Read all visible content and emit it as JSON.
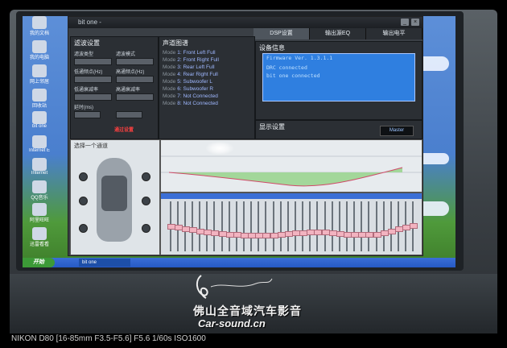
{
  "desktop": {
    "icons": [
      "我的文档",
      "我的电脑",
      "网上邻居",
      "回收站",
      "bit one",
      "Internet Explorer",
      "Internet",
      "QQ音乐",
      "阿里旺旺",
      "迅雷看看"
    ]
  },
  "app": {
    "title": "bit one -",
    "tabs": [
      "DSP设置",
      "输出源EQ",
      "输出电平"
    ],
    "filter_panel": {
      "title": "滤波设置",
      "labels": [
        "滤波类型",
        "滤波模式",
        "低通频点(Hz)",
        "高通频点(Hz)",
        "低通衰减率",
        "高通衰减率",
        "延时(ms)"
      ],
      "pass_button": "通过设置"
    },
    "channel_panel": {
      "title": "声道图谱",
      "channels": [
        "1: Front Left Full",
        "2: Front Right Full",
        "3: Rear Left Full",
        "4: Rear Right Full",
        "5: Subwoofer L",
        "6: Subwoofer R",
        "7: Not Connected",
        "8: Not Connected"
      ],
      "mode_label": "Mode"
    },
    "device_info": {
      "title": "设备信息",
      "lines": [
        "Firmware Ver. 1.3.1.1",
        "",
        "DRC connected",
        "bit one connected"
      ]
    },
    "display_panel": {
      "title": "显示设置",
      "master": "Master"
    },
    "car_panel": {
      "title": "选择一个通道"
    },
    "taskbar": {
      "start": "开始",
      "task": "bit one"
    }
  },
  "watermark": {
    "brand": "佛山全音域汽车影音",
    "site": "Car-sound.cn"
  },
  "exif": "NIKON D80 [16-85mm F3.5-F5.6] F5.6 1/60s ISO1600",
  "eq_levels": [
    0.5,
    0.52,
    0.55,
    0.58,
    0.6,
    0.63,
    0.64,
    0.66,
    0.67,
    0.68,
    0.69,
    0.7,
    0.7,
    0.69,
    0.69,
    0.68,
    0.66,
    0.65,
    0.64,
    0.62,
    0.62,
    0.63,
    0.64,
    0.66,
    0.67,
    0.67,
    0.68,
    0.68,
    0.67,
    0.64,
    0.6,
    0.56,
    0.52,
    0.48
  ]
}
